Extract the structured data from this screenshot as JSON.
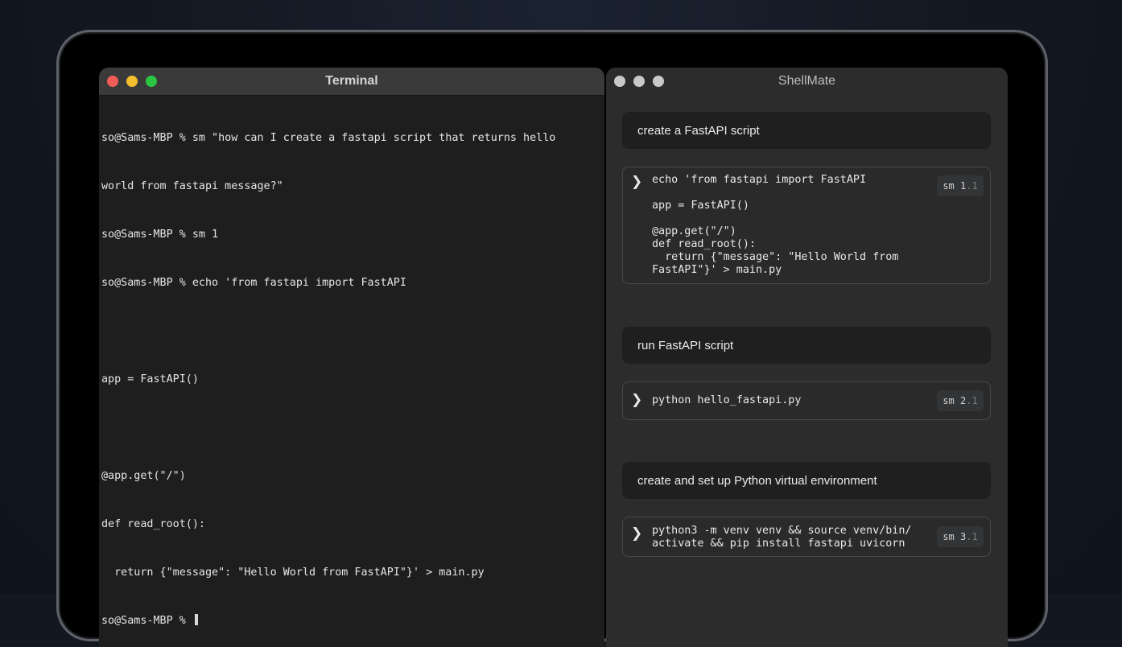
{
  "terminal": {
    "title": "Terminal",
    "lines": [
      "so@Sams-MBP % sm \"how can I create a fastapi script that returns hello",
      "world from fastapi message?\"",
      "so@Sams-MBP % sm 1",
      "so@Sams-MBP % echo 'from fastapi import FastAPI",
      "",
      "app = FastAPI()",
      "",
      "@app.get(\"/\")",
      "def read_root():",
      "  return {\"message\": \"Hello World from FastAPI\"}' > main.py"
    ],
    "prompt": "so@Sams-MBP % "
  },
  "shellmate": {
    "title": "ShellMate",
    "suggestions": [
      {
        "task": "create a FastAPI script",
        "command": "echo 'from fastapi import FastAPI\n\napp = FastAPI()\n\n@app.get(\"/\")\ndef read_root():\n  return {\"message\": \"Hello World from\nFastAPI\"}' > main.py",
        "badge_main": "sm 1",
        "badge_sub": ".1"
      },
      {
        "task": "run FastAPI script",
        "command": "python hello_fastapi.py",
        "badge_main": "sm 2",
        "badge_sub": ".1"
      },
      {
        "task": "create and set up Python virtual environment",
        "command": "python3 -m venv venv && source venv/bin/\nactivate && pip install fastapi uvicorn",
        "badge_main": "sm 3",
        "badge_sub": ".1"
      }
    ]
  },
  "colors": {
    "traffic_red": "#ee5e57",
    "traffic_yellow": "#f4bf2f",
    "traffic_green": "#2bc641"
  },
  "icons": {
    "expand": "chevron-right-icon"
  }
}
